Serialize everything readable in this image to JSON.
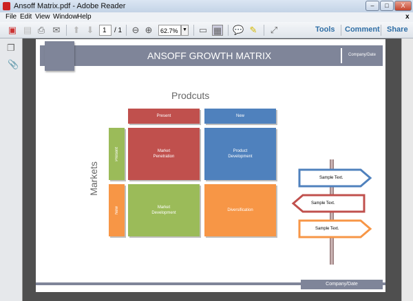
{
  "window": {
    "title": "Ansoff Matrix.pdf - Adobe Reader",
    "minimize": "–",
    "maximize": "□",
    "close": "X"
  },
  "menu": [
    "File",
    "Edit",
    "View",
    "Window",
    "Help"
  ],
  "menu_close": "x",
  "toolbar": {
    "page_current": "1",
    "page_total": "/ 1",
    "zoom": "62.7%",
    "tools": "Tools",
    "comment": "Comment",
    "share": "Share"
  },
  "document": {
    "header_title": "ANSOFF GROWTH MATRIX",
    "header_company": "Company/Date",
    "footer_company": "Company/Date",
    "products_label": "Prodcuts",
    "markets_label": "Markets",
    "col_headers": [
      "Present",
      "New"
    ],
    "row_headers": [
      "Present",
      "New"
    ],
    "cells": {
      "market_penetration": "Market Penetration",
      "product_development": "Product Development",
      "market_development": "Market Development",
      "diversification": "Diversification"
    },
    "signs": [
      "Sample Text.",
      "Sample Text.",
      "Sample Text."
    ]
  },
  "colors": {
    "red": "#c0504d",
    "blue": "#4f81bd",
    "green": "#9bbb59",
    "orange": "#f79646",
    "band": "#7f8599"
  }
}
